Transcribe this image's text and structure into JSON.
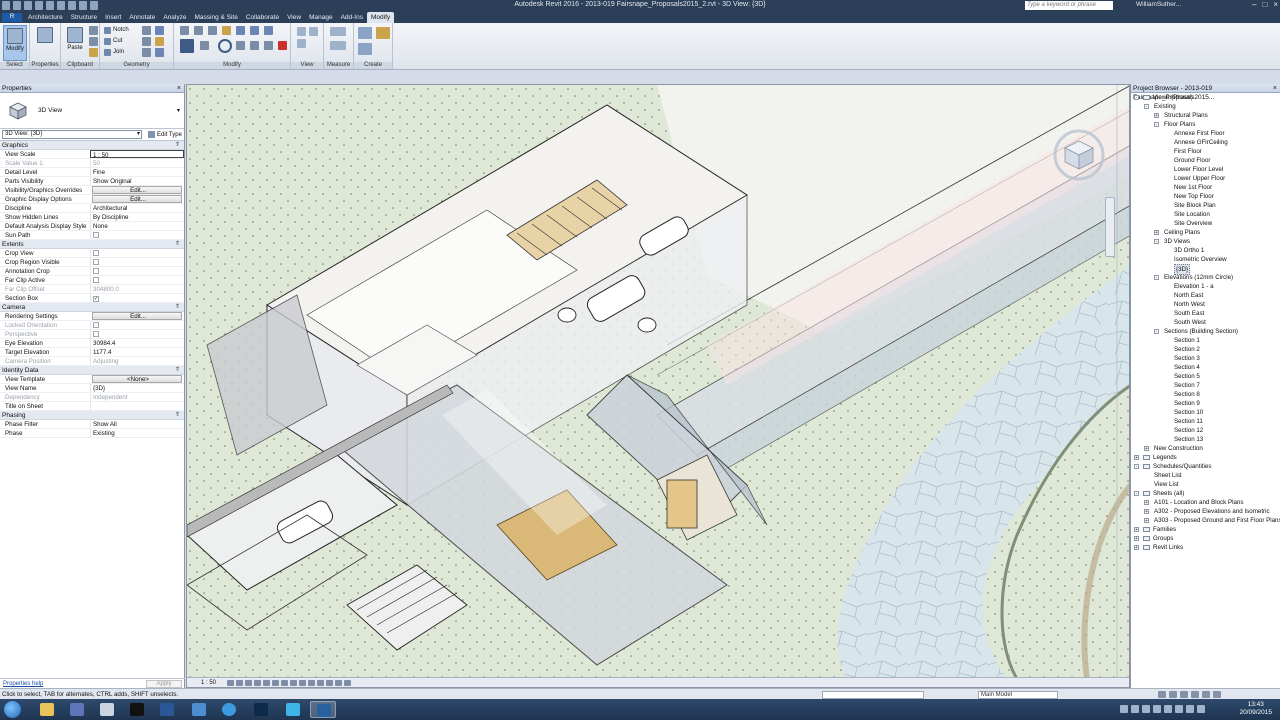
{
  "app": {
    "title": "Autodesk Revit 2016 -   2013-019 Fairsnape_Proposals2015_2.rvt - 3D View: {3D}",
    "search_placeholder": "Type a keyword or phrase",
    "user": "WilliamSuther..."
  },
  "ribbon": {
    "tabs": [
      "Architecture",
      "Structure",
      "Insert",
      "Annotate",
      "Analyze",
      "Massing & Site",
      "Collaborate",
      "View",
      "Manage",
      "Add-Ins",
      "Modify"
    ],
    "active_tab": "Modify",
    "panels": {
      "select": "Select",
      "properties": "Properties",
      "clipboard": "Clipboard",
      "geometry": "Geometry",
      "modify": "Modify",
      "view": "View",
      "measure": "Measure",
      "create": "Create"
    },
    "buttons": {
      "modify": "Modify",
      "paste": "Paste",
      "notch": "Notch",
      "cut": "Cut",
      "join": "Join"
    }
  },
  "properties": {
    "header": "Properties",
    "type_name": "3D View",
    "view_selector": "3D View: {3D}",
    "edit_type": "Edit Type",
    "groups": {
      "graphics": "Graphics",
      "extents": "Extents",
      "camera": "Camera",
      "identity": "Identity Data",
      "phasing": "Phasing"
    },
    "rows": {
      "view_scale": {
        "k": "View Scale",
        "v": "1 : 50"
      },
      "scale_value": {
        "k": "Scale Value    1:",
        "v": "50"
      },
      "detail_level": {
        "k": "Detail Level",
        "v": "Fine"
      },
      "parts_visibility": {
        "k": "Parts Visibility",
        "v": "Show Original"
      },
      "vg_overrides": {
        "k": "Visibility/Graphics Overrides",
        "v": "Edit..."
      },
      "graphic_display": {
        "k": "Graphic Display Options",
        "v": "Edit..."
      },
      "discipline": {
        "k": "Discipline",
        "v": "Architectural"
      },
      "hidden_lines": {
        "k": "Show Hidden Lines",
        "v": "By Discipline"
      },
      "analysis_style": {
        "k": "Default Analysis Display Style",
        "v": "None"
      },
      "sun_path": {
        "k": "Sun Path"
      },
      "crop_view": {
        "k": "Crop View"
      },
      "crop_visible": {
        "k": "Crop Region Visible"
      },
      "annotation_crop": {
        "k": "Annotation Crop"
      },
      "far_clip": {
        "k": "Far Clip Active"
      },
      "far_clip_offset": {
        "k": "Far Clip Offset",
        "v": "304800.0"
      },
      "section_box": {
        "k": "Section Box"
      },
      "rendering": {
        "k": "Rendering Settings",
        "v": "Edit..."
      },
      "locked_orientation": {
        "k": "Locked Orientation"
      },
      "perspective": {
        "k": "Perspective"
      },
      "eye_elevation": {
        "k": "Eye Elevation",
        "v": "30984.4"
      },
      "target_elevation": {
        "k": "Target Elevation",
        "v": "1177.4"
      },
      "camera_position": {
        "k": "Camera Position",
        "v": "Adjusting"
      },
      "view_template": {
        "k": "View Template",
        "v": "<None>"
      },
      "view_name": {
        "k": "View Name",
        "v": "{3D}"
      },
      "dependency": {
        "k": "Dependency",
        "v": "Independent"
      },
      "title_on_sheet": {
        "k": "Title on Sheet",
        "v": ""
      },
      "phase_filter": {
        "k": "Phase Filter",
        "v": "Show All"
      },
      "phase": {
        "k": "Phase",
        "v": "Existing"
      }
    },
    "help_link": "Properties help",
    "apply": "Apply"
  },
  "viewport": {
    "scale": "1 : 50"
  },
  "browser": {
    "header": "Project Browser - 2013-019 Fairsnape_Proposals2015...",
    "items": [
      {
        "label": "Views (Phase)",
        "level": 0,
        "exp": "-",
        "icon": true
      },
      {
        "label": "Existing",
        "level": 1,
        "exp": "-"
      },
      {
        "label": "Structural Plans",
        "level": 2,
        "exp": "+"
      },
      {
        "label": "Floor Plans",
        "level": 2,
        "exp": "-"
      },
      {
        "label": "Annexe First Floor",
        "level": 3
      },
      {
        "label": "Annexe GFlrCeiling",
        "level": 3
      },
      {
        "label": "First Floor",
        "level": 3
      },
      {
        "label": "Ground Floor",
        "level": 3
      },
      {
        "label": "Lower Floor Level",
        "level": 3
      },
      {
        "label": "Lower Upper Floor",
        "level": 3
      },
      {
        "label": "New 1st Floor",
        "level": 3
      },
      {
        "label": "New Top Floor",
        "level": 3
      },
      {
        "label": "Site Block Plan",
        "level": 3
      },
      {
        "label": "Site Location",
        "level": 3
      },
      {
        "label": "Site Overview",
        "level": 3
      },
      {
        "label": "Ceiling Plans",
        "level": 2,
        "exp": "+"
      },
      {
        "label": "3D Views",
        "level": 2,
        "exp": "-"
      },
      {
        "label": "3D Ortho 1",
        "level": 3
      },
      {
        "label": "Isometric Overview",
        "level": 3
      },
      {
        "label": "{3D}",
        "level": 3,
        "selected": true
      },
      {
        "label": "Elevations (12mm Circle)",
        "level": 2,
        "exp": "-"
      },
      {
        "label": "Elevation 1 - a",
        "level": 3
      },
      {
        "label": "North East",
        "level": 3
      },
      {
        "label": "North West",
        "level": 3
      },
      {
        "label": "South East",
        "level": 3
      },
      {
        "label": "South West",
        "level": 3
      },
      {
        "label": "Sections (Building Section)",
        "level": 2,
        "exp": "-"
      },
      {
        "label": "Section 1",
        "level": 3
      },
      {
        "label": "Section 2",
        "level": 3
      },
      {
        "label": "Section 3",
        "level": 3
      },
      {
        "label": "Section 4",
        "level": 3
      },
      {
        "label": "Section 5",
        "level": 3
      },
      {
        "label": "Section 7",
        "level": 3
      },
      {
        "label": "Section 8",
        "level": 3
      },
      {
        "label": "Section 9",
        "level": 3
      },
      {
        "label": "Section 10",
        "level": 3
      },
      {
        "label": "Section 11",
        "level": 3
      },
      {
        "label": "Section 12",
        "level": 3
      },
      {
        "label": "Section 13",
        "level": 3
      },
      {
        "label": "New Construction",
        "level": 1,
        "exp": "+"
      },
      {
        "label": "Legends",
        "level": 0,
        "exp": "+",
        "icon": true
      },
      {
        "label": "Schedules/Quantities",
        "level": 0,
        "exp": "-",
        "icon": true
      },
      {
        "label": "Sheet List",
        "level": 1
      },
      {
        "label": "View List",
        "level": 1
      },
      {
        "label": "Sheets (all)",
        "level": 0,
        "exp": "-",
        "icon": true
      },
      {
        "label": "A101 - Location and Block Plans",
        "level": 1,
        "exp": "+"
      },
      {
        "label": "A302 - Proposed Elevations and Isometric",
        "level": 1,
        "exp": "+"
      },
      {
        "label": "A303 - Proposed Ground and First Floor Plans",
        "level": 1,
        "exp": "+"
      },
      {
        "label": "Families",
        "level": 0,
        "exp": "+",
        "icon": true
      },
      {
        "label": "Groups",
        "level": 0,
        "exp": "+",
        "icon": true
      },
      {
        "label": "Revit Links",
        "level": 0,
        "exp": "+",
        "icon": true
      }
    ]
  },
  "status": {
    "message": "Click to select, TAB for alternates, CTRL adds, SHIFT unselects.",
    "workset": "Main Model"
  },
  "taskbar": {
    "time": "13:43",
    "date": "20/09/2015"
  },
  "colors": {
    "titlebar": "#2b3f58",
    "ground": "#dfe8d6",
    "path": "#d8e6ec",
    "timber": "#d9b878"
  }
}
